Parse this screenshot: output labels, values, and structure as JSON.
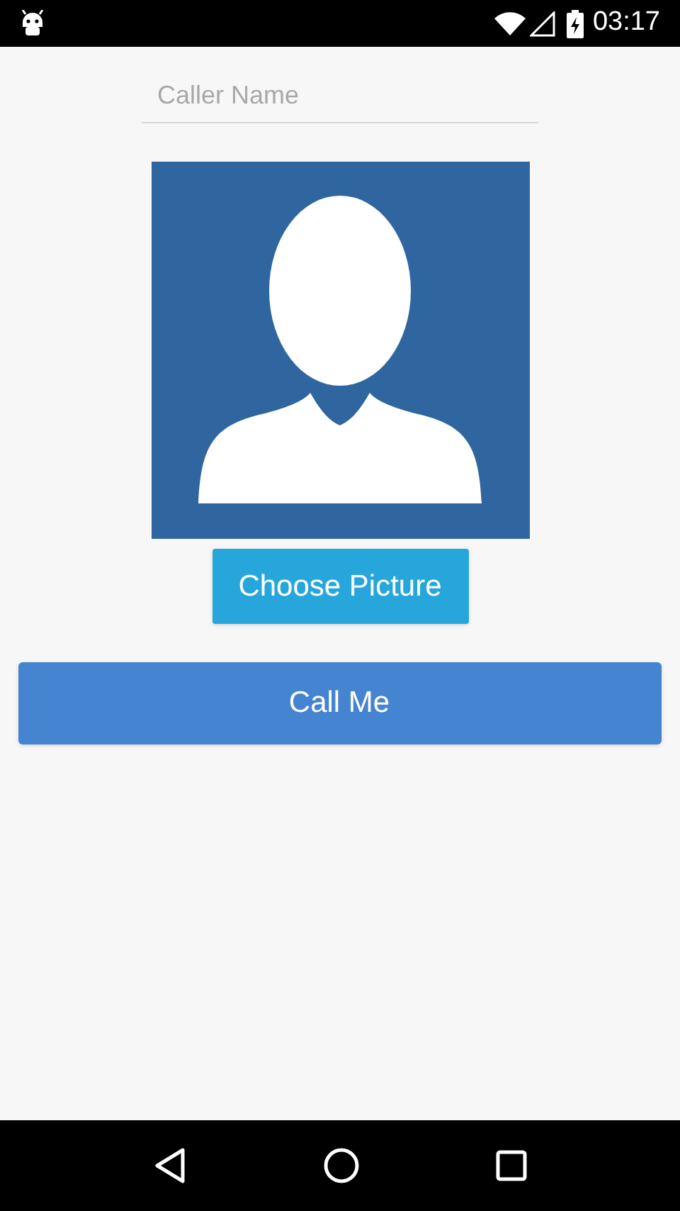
{
  "status_bar": {
    "time": "03:17"
  },
  "caller_name": {
    "placeholder": "Caller Name"
  },
  "choose_picture_button": {
    "label": "Choose Picture"
  },
  "call_button": {
    "label": "Call Me"
  }
}
